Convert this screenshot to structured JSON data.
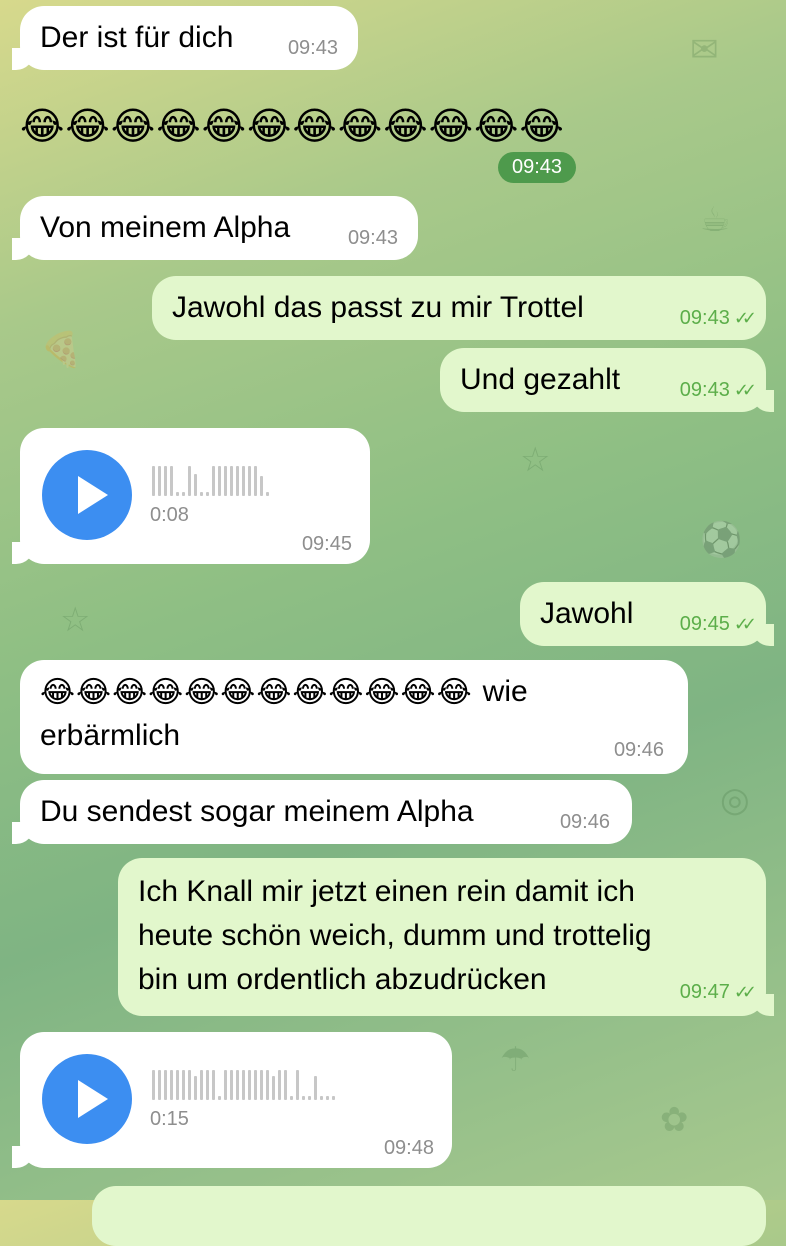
{
  "messages": [
    {
      "text": "Der ist für dich",
      "time": "09:43"
    },
    {
      "emoji": "😂😂😂😂😂😂😂😂😂😂😂😂",
      "time": "09:43"
    },
    {
      "text": "Von meinem Alpha",
      "time": "09:43"
    },
    {
      "text": "Jawohl das passt zu mir Trottel",
      "time": "09:43"
    },
    {
      "text": "Und gezahlt",
      "time": "09:43"
    },
    {
      "voice_duration": "0:08",
      "time": "09:45"
    },
    {
      "text": "Jawohl",
      "time": "09:45"
    },
    {
      "emoji": "😂😂😂😂😂😂😂😂😂😂😂😂",
      "text_line1": "wie",
      "text_line2": "erbärmlich",
      "time": "09:46"
    },
    {
      "text": "Du sendest sogar meinem Alpha",
      "time": "09:46"
    },
    {
      "line1": "Ich Knall mir jetzt einen rein damit ich",
      "line2": "heute schön weich, dumm und trottelig",
      "line3": "bin um ordentlich abzudrücken",
      "time": "09:47"
    },
    {
      "voice_duration": "0:15",
      "time": "09:48"
    }
  ],
  "colors": {
    "incoming_bubble": "#ffffff",
    "outgoing_bubble": "#e2f7cc",
    "outgoing_time": "#5cae4a",
    "play_button": "#3c8ef1",
    "time_pill": "#4e9a4c"
  },
  "icons": {
    "read_receipt": "double-check-icon",
    "play": "play-icon"
  }
}
